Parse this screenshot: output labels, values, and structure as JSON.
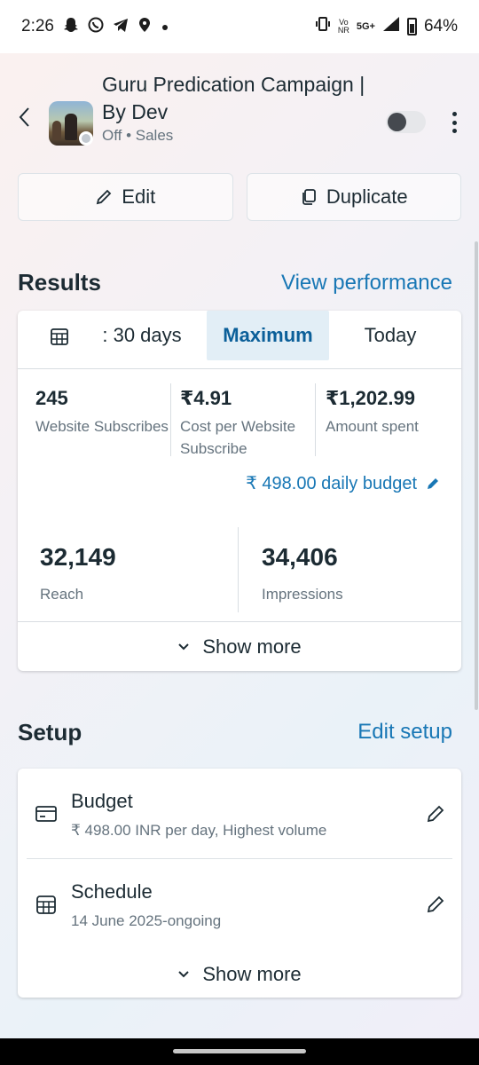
{
  "status_bar": {
    "time": "2:26",
    "network_top": "Vo",
    "network_bottom": "NR",
    "network_type": "5G+",
    "battery": "64%",
    "notification_icons": [
      "snapchat-icon",
      "whatsapp-icon",
      "telegram-icon",
      "location-icon",
      "dot-icon"
    ]
  },
  "header": {
    "title": "Guru Predication Campaign | By Dev",
    "subtitle": "Off • Sales",
    "toggle_on": false
  },
  "actions": {
    "edit_label": "Edit",
    "duplicate_label": "Duplicate"
  },
  "results": {
    "title": "Results",
    "link": "View performance",
    "tabs": [
      {
        "label": ": 30 days",
        "active": false
      },
      {
        "label": "Maximum",
        "active": true
      },
      {
        "label": "Today",
        "active": false
      }
    ],
    "metrics": [
      {
        "value": "245",
        "label": "Website Subscribes"
      },
      {
        "value": "₹4.91",
        "label": "Cost per Website Subscribe"
      },
      {
        "value": "₹1,202.99",
        "label": "Amount spent"
      }
    ],
    "budget_link": "₹ 498.00 daily budget",
    "big_metrics": [
      {
        "value": "32,149",
        "label": "Reach"
      },
      {
        "value": "34,406",
        "label": "Impressions"
      }
    ],
    "show_more": "Show more"
  },
  "setup": {
    "title": "Setup",
    "link": "Edit setup",
    "items": [
      {
        "title": "Budget",
        "subtitle": "₹ 498.00 INR per day, Highest volume",
        "icon": "card-icon"
      },
      {
        "title": "Schedule",
        "subtitle": "14 June 2025-ongoing",
        "icon": "calendar-icon"
      }
    ],
    "show_more": "Show more"
  },
  "colors": {
    "accent": "#1877b5",
    "active_tab_bg": "#e2eef6",
    "text_primary": "#1c2b33",
    "text_secondary": "#65737e"
  }
}
